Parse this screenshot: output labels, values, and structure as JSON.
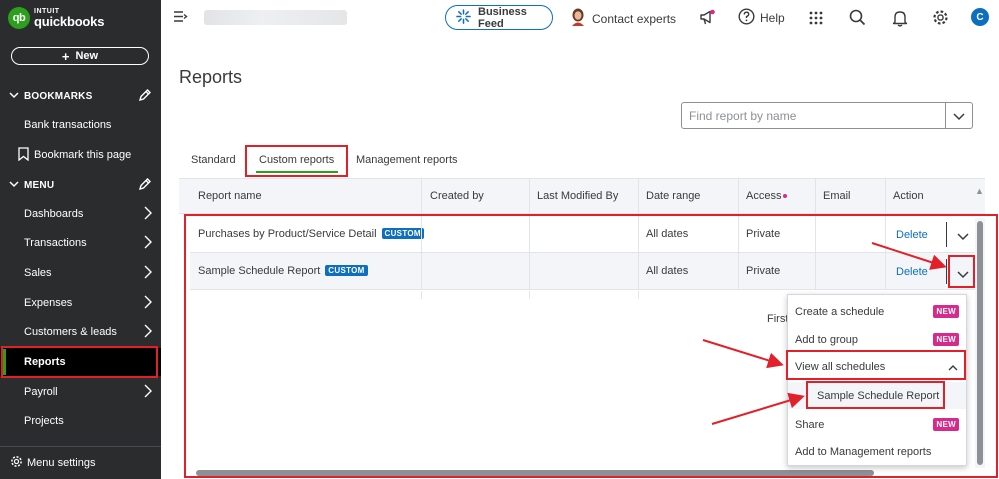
{
  "sidebar": {
    "logo_intuit": "INTUIT",
    "logo_name": "quickbooks",
    "logo_badge": "qb",
    "new_button": "New",
    "bookmarks_header": "BOOKMARKS",
    "bookmarks": [
      {
        "label": "Bank transactions",
        "icon": "none"
      },
      {
        "label": "Bookmark this page",
        "icon": "bookmark-icon"
      }
    ],
    "menu_header": "MENU",
    "menu_items": [
      {
        "label": "Dashboards",
        "has_arrow": true
      },
      {
        "label": "Transactions",
        "has_arrow": true
      },
      {
        "label": "Sales",
        "has_arrow": true
      },
      {
        "label": "Expenses",
        "has_arrow": true
      },
      {
        "label": "Customers & leads",
        "has_arrow": true
      },
      {
        "label": "Reports",
        "has_arrow": false,
        "active": true
      },
      {
        "label": "Payroll",
        "has_arrow": true
      },
      {
        "label": "Projects",
        "has_arrow": false
      }
    ],
    "footer": "Menu settings"
  },
  "topbar": {
    "business_feed": "Business Feed",
    "contact_experts": "Contact experts",
    "help": "Help",
    "avatar_initial": "C",
    "icons": [
      "hamburger-icon",
      "sparkle-icon",
      "expert-avatar-icon",
      "megaphone-icon",
      "help-icon",
      "apps-grid-icon",
      "search-icon",
      "bell-icon",
      "gear-icon"
    ]
  },
  "page": {
    "title": "Reports",
    "search_placeholder": "Find report by name",
    "tabs": [
      "Standard",
      "Custom reports",
      "Management reports"
    ],
    "active_tab": "Custom reports"
  },
  "table": {
    "columns": [
      "Report name",
      "Created by",
      "Last Modified By",
      "Date range",
      "Access",
      "Email",
      "Action"
    ],
    "rows": [
      {
        "name": "Purchases by Product/Service Detail",
        "badge": "CUSTOM",
        "created_by": "",
        "modified_by": "",
        "date_range": "All dates",
        "access": "Private",
        "email": "",
        "action": "Delete"
      },
      {
        "name": "Sample Schedule Report",
        "badge": "CUSTOM",
        "created_by": "",
        "modified_by": "",
        "date_range": "All dates",
        "access": "Private",
        "email": "",
        "action": "Delete"
      }
    ],
    "pager_text": "First"
  },
  "action_menu": {
    "items": [
      {
        "label": "Create a schedule",
        "badge": "NEW"
      },
      {
        "label": "Add to group",
        "badge": "NEW"
      },
      {
        "label": "View all schedules",
        "expanded": true
      },
      {
        "label": "Sample Schedule Report",
        "submenu": true
      },
      {
        "label": "Share",
        "badge": "NEW"
      },
      {
        "label": "Add to Management reports"
      }
    ]
  },
  "colors": {
    "sidebar_bg": "#2b2c2e",
    "brand_green": "#2ca01c",
    "link_blue": "#0d6fbd",
    "new_badge_magenta": "#d52b8c",
    "annotation_red": "#e2202a"
  }
}
